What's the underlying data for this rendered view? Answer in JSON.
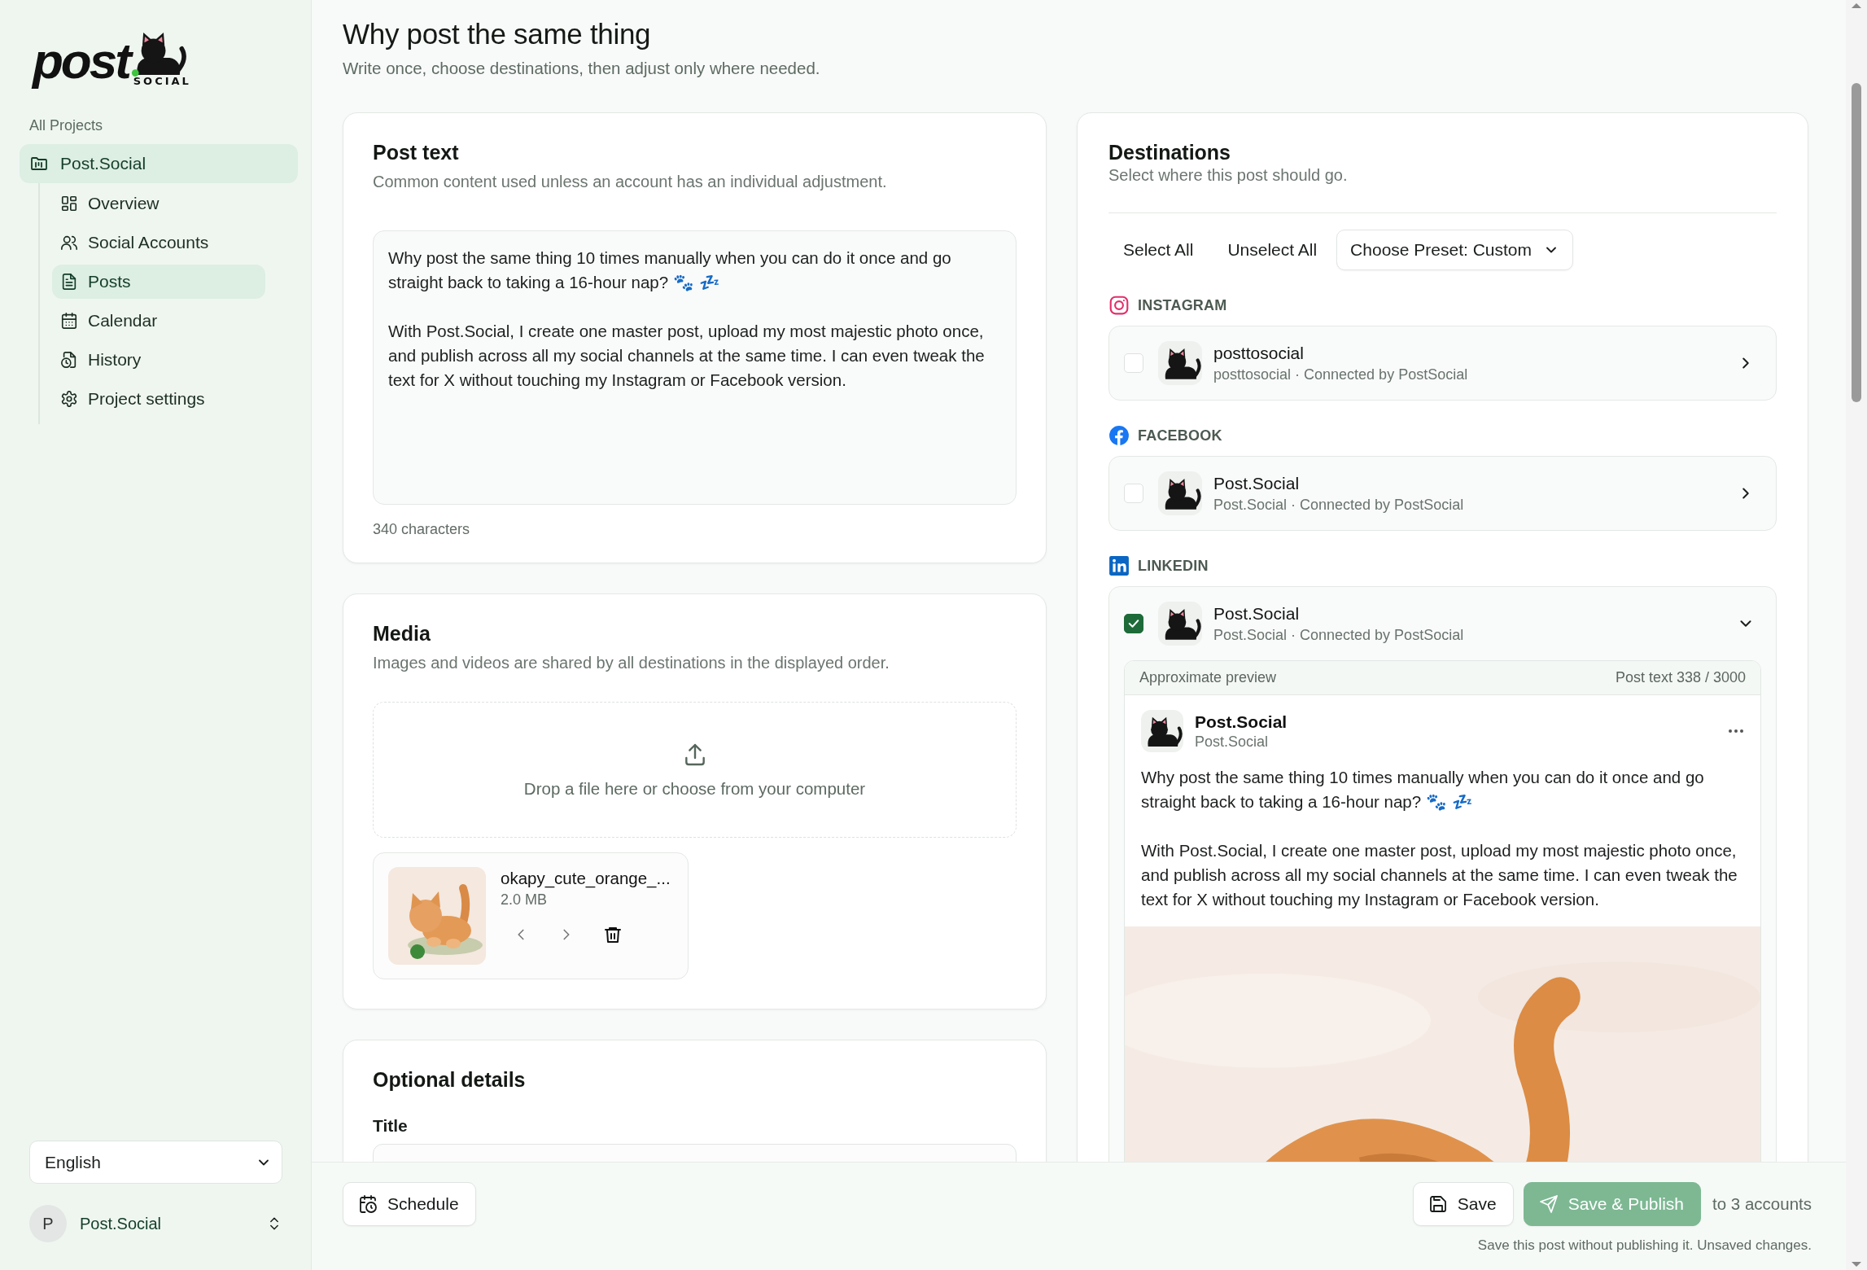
{
  "logo": {
    "wordmark": "post",
    "tagline": "SOCIAL"
  },
  "sidebar": {
    "section": "All Projects",
    "project": {
      "label": "Post.Social",
      "selected": true
    },
    "items": [
      {
        "label": "Overview",
        "kind": "overview",
        "selected": false
      },
      {
        "label": "Social Accounts",
        "kind": "accounts",
        "selected": false
      },
      {
        "label": "Posts",
        "kind": "posts",
        "selected": true
      },
      {
        "label": "Calendar",
        "kind": "calendar",
        "selected": false
      },
      {
        "label": "History",
        "kind": "history",
        "selected": false
      },
      {
        "label": "Project settings",
        "kind": "settings",
        "selected": false
      }
    ],
    "language": "English",
    "user": {
      "initial": "P",
      "name": "Post.Social"
    }
  },
  "page": {
    "title": "Why post the same thing",
    "subtitle": "Write once, choose destinations, then adjust only where needed."
  },
  "post_text": {
    "title": "Post text",
    "description": "Common content used unless an account has an individual adjustment.",
    "value": "Why post the same thing 10 times manually when you can do it once and go straight back to taking a 16-hour nap? 🐾 💤\n\nWith Post.Social, I create one master post, upload my most majestic photo once, and publish across all my social channels at the same time. I can even tweak the text for X without touching my Instagram or Facebook version.",
    "count": "340 characters"
  },
  "media": {
    "title": "Media",
    "description": "Images and videos are shared by all destinations in the displayed order.",
    "dropzone": "Drop a file here or choose from your computer",
    "files": [
      {
        "name": "okapy_cute_orange_...",
        "size": "2.0 MB",
        "kind": "picture"
      }
    ]
  },
  "optional_details": {
    "title": "Optional details",
    "field_label": "Title"
  },
  "destinations": {
    "title": "Destinations",
    "description": "Select where this post should go.",
    "actions": [
      "Select All",
      "Unselect All"
    ],
    "preset": "Choose Preset: Custom",
    "groups": [
      {
        "network": "INSTAGRAM",
        "kind": "instagram",
        "accounts": [
          {
            "name": "posttosocial",
            "detail": "posttosocial · Connected by PostSocial",
            "checked": false,
            "expanded": false
          }
        ]
      },
      {
        "network": "FACEBOOK",
        "kind": "facebook",
        "accounts": [
          {
            "name": "Post.Social",
            "detail": "Post.Social · Connected by PostSocial",
            "checked": false,
            "expanded": false
          }
        ]
      },
      {
        "network": "LINKEDIN",
        "kind": "linkedin",
        "accounts": [
          {
            "name": "Post.Social",
            "detail": "Post.Social · Connected by PostSocial",
            "checked": true,
            "expanded": true,
            "preview": {
              "label": "Approximate preview",
              "count": "Post text 338 / 3000",
              "name": "Post.Social",
              "handle": "Post.Social",
              "text": "Why post the same thing 10 times manually when you can do it once and go straight back to taking a 16-hour nap? 🐾 💤\n\nWith Post.Social, I create one master post, upload my most majestic photo once, and publish across all my social channels at the same time. I can even tweak the text for X without touching my Instagram or Facebook version."
            }
          }
        ]
      }
    ]
  },
  "footer": {
    "schedule": "Schedule",
    "save": "Save",
    "publish": "Save & Publish",
    "recipients": "to 3 accounts",
    "hint": "Save this post without publishing it. Unsaved changes."
  }
}
